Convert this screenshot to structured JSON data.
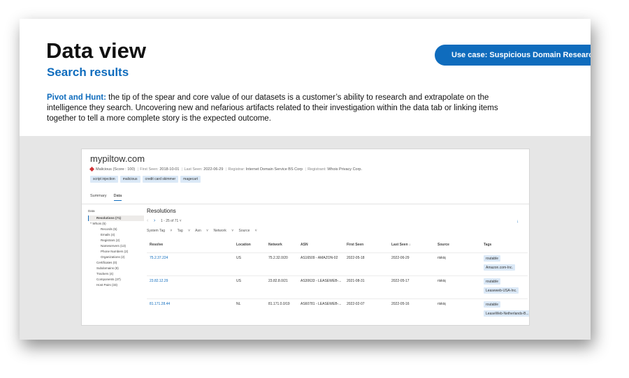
{
  "slide": {
    "title": "Data view",
    "subtitle": "Search results",
    "use_case_label": "Use case: Suspicious Domain Research",
    "description_lead": "Pivot and Hunt:",
    "description_body": " the tip of the spear and core value of our datasets is a customer’s ability to research and extrapolate on the intelligence they search. Uncovering new and nefarious artifacts related to their investigation within the data tab or linking items together to tell a more complete story is the expected outcome."
  },
  "app": {
    "domain": "mypiltow.com",
    "reputation": "Malicious (Score : 100)",
    "first_seen_label": "First Seen:",
    "first_seen": "2018-10-01",
    "last_seen_label": "Last Seen:",
    "last_seen": "2022-06-29",
    "registrar_label": "Registrar:",
    "registrar": "Internet Domain Service BS Corp",
    "registrant_label": "Registrant:",
    "registrant": "Whois Privacy Corp.",
    "tags": [
      "script injection",
      "malicious",
      "credit card skimmer",
      "magecart"
    ],
    "tabs": [
      "Summary",
      "Data"
    ],
    "sidebar": {
      "heading": "Data",
      "items": [
        "Resolutions (71)",
        "Whois (5)",
        "Records (5)",
        "Emails (4)",
        "Registrars (2)",
        "Nameservers (13)",
        "Phone Numbers (2)",
        "Organizations (2)",
        "Certificates (0)",
        "Subdomains (8)",
        "Trackers (4)",
        "Components (37)",
        "Host Pairs (33)"
      ]
    },
    "main": {
      "title": "Resolutions",
      "pager": "1 - 25 of 71",
      "filters": [
        "System Tag",
        "Tag",
        "Asn",
        "Network",
        "Source"
      ],
      "columns": [
        "Resolve",
        "Location",
        "Network",
        "ASN",
        "First Seen",
        "Last Seen ↓",
        "Source",
        "Tags"
      ],
      "rows": [
        {
          "resolve": "75.2.37.224",
          "location": "US",
          "network": "75.2.32.0/20",
          "asn": "AS16509 - AMAZON-02",
          "first_seen": "2022-05-18",
          "last_seen": "2022-06-29",
          "source": "riskiq",
          "tags": [
            "routable",
            "Amazon.com-Inc."
          ]
        },
        {
          "resolve": "23.82.12.29",
          "location": "US",
          "network": "23.82.8.0/21",
          "asn": "AS30633 - LEASEWEB-...",
          "first_seen": "2021-08-31",
          "last_seen": "2022-05-17",
          "source": "riskiq",
          "tags": [
            "routable",
            "Leaseweb-USA-Inc."
          ]
        },
        {
          "resolve": "81.171.28.44",
          "location": "NL",
          "network": "81.171.0.0/19",
          "asn": "AS60781 - LEASEWEB-...",
          "first_seen": "2022-02-07",
          "last_seen": "2022-05-16",
          "source": "riskiq",
          "tags": [
            "routable",
            "LeaseWeb-Netherlands-B..."
          ]
        }
      ]
    }
  }
}
